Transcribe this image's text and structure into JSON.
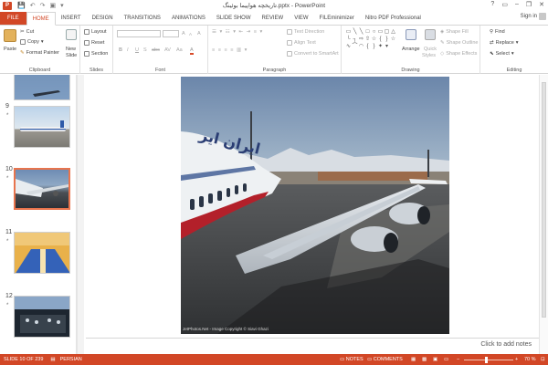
{
  "window": {
    "title": "تاریخچه هواپیما بوئینگ.pptx - PowerPoint",
    "controls": [
      "?",
      "▭",
      "–",
      "❐",
      "✕"
    ]
  },
  "app": {
    "icon_label": "P"
  },
  "qat": [
    "💾",
    "↶",
    "↷",
    "▣",
    "▾"
  ],
  "tabs": [
    {
      "label": "FILE",
      "type": "file"
    },
    {
      "label": "HOME",
      "type": "active"
    },
    {
      "label": "INSERT"
    },
    {
      "label": "DESIGN"
    },
    {
      "label": "TRANSITIONS"
    },
    {
      "label": "ANIMATIONS"
    },
    {
      "label": "SLIDE SHOW"
    },
    {
      "label": "REVIEW"
    },
    {
      "label": "VIEW"
    },
    {
      "label": "FILEminimizer"
    },
    {
      "label": "Nitro PDF Professional"
    }
  ],
  "account": {
    "signin": "Sign in"
  },
  "ribbon": {
    "clipboard": {
      "label": "Clipboard",
      "paste": "Paste",
      "cut": "Cut",
      "copy": "Copy",
      "format_painter": "Format Painter"
    },
    "slides": {
      "label": "Slides",
      "new_slide": "New",
      "new_slide2": "Slide",
      "layout": "Layout",
      "reset": "Reset",
      "section": "Section"
    },
    "font": {
      "label": "Font",
      "bold": "B",
      "italic": "I",
      "underline": "U",
      "strike": "S",
      "shadow": "abc",
      "spacing": "AV",
      "case": "Aa",
      "grow": "A",
      "shrink": "A",
      "clear": "A",
      "color": "A"
    },
    "paragraph": {
      "label": "Paragraph",
      "text_direction": "Text Direction",
      "align_text": "Align Text",
      "convert_smartart": "Convert to SmartArt"
    },
    "drawing": {
      "label": "Drawing",
      "arrange": "Arrange",
      "quick_styles": "Quick",
      "quick_styles2": "Styles",
      "shape_fill": "Shape Fill",
      "shape_outline": "Shape Outline",
      "shape_effects": "Shape Effects"
    },
    "editing": {
      "label": "Editing",
      "find": "Find",
      "replace": "Replace",
      "select": "Select"
    }
  },
  "thumbnails": [
    {
      "number": "",
      "star": ""
    },
    {
      "number": "9",
      "star": "*"
    },
    {
      "number": "10",
      "star": "*",
      "selected": true
    },
    {
      "number": "11",
      "star": "*"
    },
    {
      "number": "12",
      "star": "*"
    }
  ],
  "slide": {
    "caption": "JetPhotos.Net - Image Copyright © Siavi Ghazi",
    "fuselage_text": "ایران ایر"
  },
  "notes": {
    "placeholder": "Click to add notes"
  },
  "status": {
    "slide_info": "SLIDE 10 OF 239",
    "language": "PERSIAN",
    "notes": "NOTES",
    "comments": "COMMENTS",
    "zoom": "70 %",
    "zoom_minus": "−",
    "zoom_plus": "+"
  },
  "colors": {
    "accent": "#d24726",
    "slide_sky": "#7f98b3",
    "fuselage": "#e8ecef",
    "stripe": "#b3202a"
  }
}
